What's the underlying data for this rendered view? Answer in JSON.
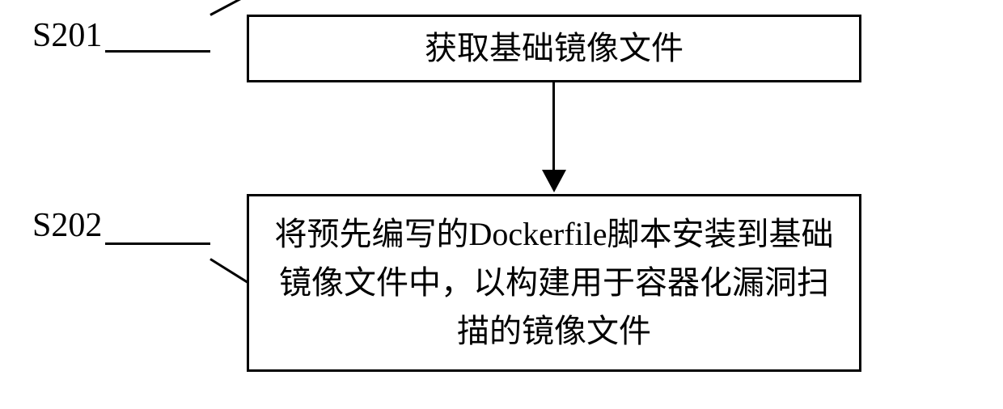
{
  "steps": [
    {
      "id": "S201",
      "label": "S201",
      "text": "获取基础镜像文件"
    },
    {
      "id": "S202",
      "label": "S202",
      "text": "将预先编写的Dockerfile脚本安装到基础镜像文件中，以构建用于容器化漏洞扫描的镜像文件"
    }
  ]
}
